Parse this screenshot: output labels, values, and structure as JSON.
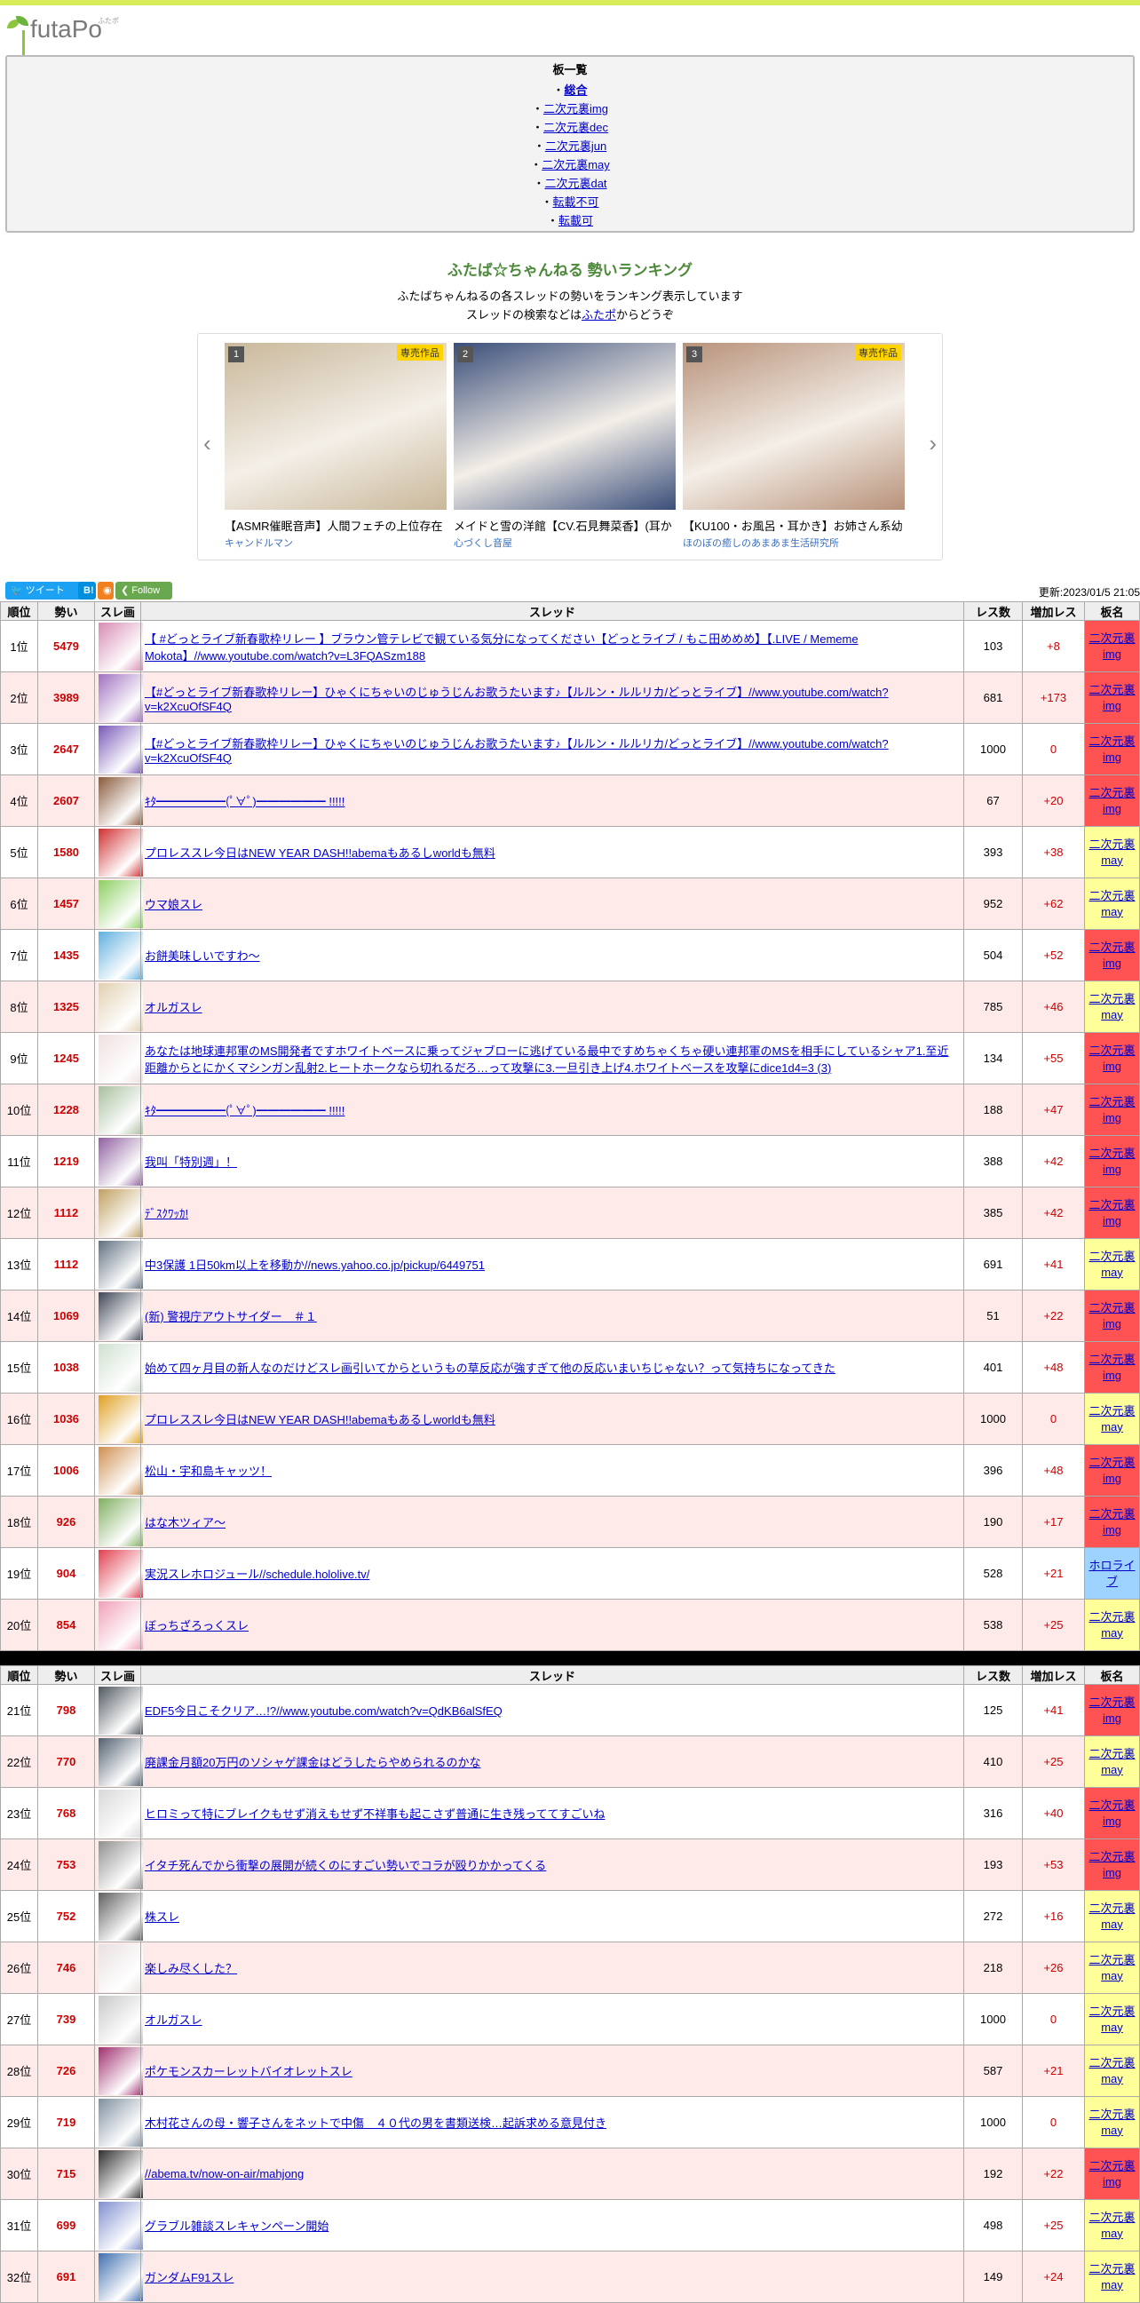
{
  "logo": {
    "text": "futaPo",
    "ruby": "ふたポ"
  },
  "boards": {
    "heading": "板一覧",
    "items": [
      "総合",
      "二次元裏img",
      "二次元裏dec",
      "二次元裏jun",
      "二次元裏may",
      "二次元裏dat",
      "転載不可",
      "転載可"
    ]
  },
  "header": {
    "title": "ふたば☆ちゃんねる 勢いランキング",
    "desc1": "ふたばちゃんねるの各スレッドの勢いをランキング表示しています",
    "desc2_pre": "スレッドの検索などは",
    "desc2_link": "ふたポ",
    "desc2_post": "からどうぞ"
  },
  "carousel": [
    {
      "num": "1",
      "badge": "専売作品",
      "caption": "【ASMR催眠音声】人間フェチの上位存在",
      "circle": "キャンドルマン",
      "color": "#c9b89a"
    },
    {
      "num": "2",
      "badge": "",
      "caption": "メイドと雪の洋館【CV.石見舞菜香】(耳か",
      "circle": "心づくし音屋",
      "color": "#3a4e7a"
    },
    {
      "num": "3",
      "badge": "専売作品",
      "caption": "【KU100・お風呂・耳かき】お姉さん系幼",
      "circle": "ほのぼの癒しのあまあま生活研究所",
      "color": "#b8927a"
    }
  ],
  "social": {
    "tweet": "ツイート",
    "b": "B!",
    "follow": "Follow",
    "updated": "更新:2023/01/5 21:05"
  },
  "table_headers": [
    "順位",
    "勢い",
    "スレ画",
    "スレッド",
    "レス数",
    "増加レス",
    "板名"
  ],
  "rows": [
    {
      "rank": "1位",
      "ikioi": "5479",
      "title": "【 #どっとライブ新春歌枠リレー 】ブラウン管テレビで観ている気分になってください【どっとライブ / もこ田めめめ】【.LIVE / Mememe Mokota】//www.youtube.com/watch?v=L3FQASzm188",
      "res": "103",
      "inc": "+8",
      "board": "二次元裏img",
      "type": "img",
      "thumb": "#d88cb4"
    },
    {
      "rank": "2位",
      "ikioi": "3989",
      "title": "【#どっとライブ新春歌枠リレー】ひゃくにちゃいのじゅうじんお歌うたいます♪【ルルン・ルルリカ/どっとライブ】//www.youtube.com/watch?v=k2XcuOfSF4Q",
      "res": "681",
      "inc": "+173",
      "board": "二次元裏img",
      "type": "img",
      "thumb": "#a070c0"
    },
    {
      "rank": "3位",
      "ikioi": "2647",
      "title": "【#どっとライブ新春歌枠リレー】ひゃくにちゃいのじゅうじんお歌うたいます♪【ルルン・ルルリカ/どっとライブ】//www.youtube.com/watch?v=k2XcuOfSF4Q",
      "res": "1000",
      "inc": "0",
      "board": "二次元裏img",
      "type": "img",
      "thumb": "#7858b8"
    },
    {
      "rank": "4位",
      "ikioi": "2607",
      "title": "ｷﾀ━━━━━━(ﾟ∀ﾟ)━━━━━━ !!!!!",
      "res": "67",
      "inc": "+20",
      "board": "二次元裏img",
      "type": "img",
      "thumb": "#8a5a3a"
    },
    {
      "rank": "5位",
      "ikioi": "1580",
      "title": "プロレススレ今日はNEW YEAR DASH!!abemaもあるしworldも無料",
      "res": "393",
      "inc": "+38",
      "board": "二次元裏may",
      "type": "may",
      "thumb": "#d03030"
    },
    {
      "rank": "6位",
      "ikioi": "1457",
      "title": "ウマ娘スレ",
      "res": "952",
      "inc": "+62",
      "board": "二次元裏may",
      "type": "may",
      "thumb": "#8cd060"
    },
    {
      "rank": "7位",
      "ikioi": "1435",
      "title": "お餅美味しいですわ～",
      "res": "504",
      "inc": "+52",
      "board": "二次元裏img",
      "type": "img",
      "thumb": "#60b0e0"
    },
    {
      "rank": "8位",
      "ikioi": "1325",
      "title": "オルガスレ",
      "res": "785",
      "inc": "+46",
      "board": "二次元裏may",
      "type": "may",
      "thumb": "#e0d0b0"
    },
    {
      "rank": "9位",
      "ikioi": "1245",
      "title": "あなたは地球連邦軍のMS開発者ですホワイトベースに乗ってジャブローに逃げている最中ですめちゃくちゃ硬い連邦軍のMSを相手にしているシャア1.至近距離からとにかくマシンガン乱射2.ヒートホークなら切れるだろ…って攻撃に3.一旦引き上げ4.ホワイトベースを攻撃にdice1d4=3 (3)",
      "res": "134",
      "inc": "+55",
      "board": "二次元裏img",
      "type": "img",
      "thumb": "#f0e0e0"
    },
    {
      "rank": "10位",
      "ikioi": "1228",
      "title": "ｷﾀ━━━━━━(ﾟ∀ﾟ)━━━━━━ !!!!!",
      "res": "188",
      "inc": "+47",
      "board": "二次元裏img",
      "type": "img",
      "thumb": "#a8c0a0"
    },
    {
      "rank": "11位",
      "ikioi": "1219",
      "title": "我叫「特別週」！",
      "res": "388",
      "inc": "+42",
      "board": "二次元裏img",
      "type": "img",
      "thumb": "#9060a0"
    },
    {
      "rank": "12位",
      "ikioi": "1112",
      "title": "ﾃﾞｽｸﾜｯｶ!",
      "res": "385",
      "inc": "+42",
      "board": "二次元裏img",
      "type": "img",
      "thumb": "#c0a060"
    },
    {
      "rank": "13位",
      "ikioi": "1112",
      "title": "中3保護 1日50km以上を移動か//news.yahoo.co.jp/pickup/6449751",
      "res": "691",
      "inc": "+41",
      "board": "二次元裏may",
      "type": "may",
      "thumb": "#607080"
    },
    {
      "rank": "14位",
      "ikioi": "1069",
      "title": "(新) 警視庁アウトサイダー　＃１",
      "res": "51",
      "inc": "+22",
      "board": "二次元裏img",
      "type": "img",
      "thumb": "#404858"
    },
    {
      "rank": "15位",
      "ikioi": "1038",
      "title": "始めて四ヶ月目の新人なのだけどスレ画引いてからというもの草反応が強すぎて他の反応いまいちじゃない？って気持ちになってきた",
      "res": "401",
      "inc": "+48",
      "board": "二次元裏img",
      "type": "img",
      "thumb": "#d0e0d0"
    },
    {
      "rank": "16位",
      "ikioi": "1036",
      "title": "プロレススレ今日はNEW YEAR DASH!!abemaもあるしworldも無料",
      "res": "1000",
      "inc": "0",
      "board": "二次元裏may",
      "type": "may",
      "thumb": "#e0a020"
    },
    {
      "rank": "17位",
      "ikioi": "1006",
      "title": "松山・宇和島キャッツ！",
      "res": "396",
      "inc": "+48",
      "board": "二次元裏img",
      "type": "img",
      "thumb": "#d09050"
    },
    {
      "rank": "18位",
      "ikioi": "926",
      "title": "はな木ツィア～",
      "res": "190",
      "inc": "+17",
      "board": "二次元裏img",
      "type": "img",
      "thumb": "#80b060"
    },
    {
      "rank": "19位",
      "ikioi": "904",
      "title": "実況スレホロジュール//schedule.hololive.tv/",
      "res": "528",
      "inc": "+21",
      "board": "ホロライブ",
      "type": "holo",
      "thumb": "#e04050"
    },
    {
      "rank": "20位",
      "ikioi": "854",
      "title": "ぼっちざろっくスレ",
      "res": "538",
      "inc": "+25",
      "board": "二次元裏may",
      "type": "may",
      "thumb": "#f0a0b8"
    }
  ],
  "rows2": [
    {
      "rank": "21位",
      "ikioi": "798",
      "title": "EDF5今日こそクリア…!?//www.youtube.com/watch?v=QdKB6alSfEQ",
      "res": "125",
      "inc": "+41",
      "board": "二次元裏img",
      "type": "img",
      "thumb": "#505860"
    },
    {
      "rank": "22位",
      "ikioi": "770",
      "title": "廃課金月額20万円のソシャゲ課金はどうしたらやめられるのかな",
      "res": "410",
      "inc": "+25",
      "board": "二次元裏may",
      "type": "may",
      "thumb": "#506070"
    },
    {
      "rank": "23位",
      "ikioi": "768",
      "title": "ヒロミって特にブレイクもせず消えもせず不祥事も起こさず普通に生き残っててすごいね",
      "res": "316",
      "inc": "+40",
      "board": "二次元裏img",
      "type": "img",
      "thumb": "#d8d8d8"
    },
    {
      "rank": "24位",
      "ikioi": "753",
      "title": "イタチ死んでから衝撃の展開が続くのにすごい勢いでコラが殴りかかってくる",
      "res": "193",
      "inc": "+53",
      "board": "二次元裏img",
      "type": "img",
      "thumb": "#909090"
    },
    {
      "rank": "25位",
      "ikioi": "752",
      "title": "株スレ",
      "res": "272",
      "inc": "+16",
      "board": "二次元裏may",
      "type": "may",
      "thumb": "#606060"
    },
    {
      "rank": "26位",
      "ikioi": "746",
      "title": "楽しみ尽くした？",
      "res": "218",
      "inc": "+26",
      "board": "二次元裏may",
      "type": "may",
      "thumb": "#e8e0e0"
    },
    {
      "rank": "27位",
      "ikioi": "739",
      "title": "オルガスレ",
      "res": "1000",
      "inc": "0",
      "board": "二次元裏may",
      "type": "may",
      "thumb": "#c8c8c8"
    },
    {
      "rank": "28位",
      "ikioi": "726",
      "title": "ポケモンスカーレットバイオレットスレ",
      "res": "587",
      "inc": "+21",
      "board": "二次元裏may",
      "type": "may",
      "thumb": "#a03070"
    },
    {
      "rank": "29位",
      "ikioi": "719",
      "title": "木村花さんの母・響子さんをネットで中傷　４０代の男を書類送検…起訴求める意見付き",
      "res": "1000",
      "inc": "0",
      "board": "二次元裏may",
      "type": "may",
      "thumb": "#8090a0"
    },
    {
      "rank": "30位",
      "ikioi": "715",
      "title": "//abema.tv/now-on-air/mahjong",
      "res": "192",
      "inc": "+22",
      "board": "二次元裏img",
      "type": "img",
      "thumb": "#303030"
    },
    {
      "rank": "31位",
      "ikioi": "699",
      "title": "グラブル雑談スレキャンペーン開始",
      "res": "498",
      "inc": "+25",
      "board": "二次元裏may",
      "type": "may",
      "thumb": "#8090d0"
    },
    {
      "rank": "32位",
      "ikioi": "691",
      "title": "ガンダムF91スレ",
      "res": "149",
      "inc": "+24",
      "board": "二次元裏may",
      "type": "may",
      "thumb": "#4070b0"
    }
  ],
  "board_colors": {
    "img": "#ff5252",
    "may": "#ffff99",
    "holo": "#9fd3ff"
  }
}
